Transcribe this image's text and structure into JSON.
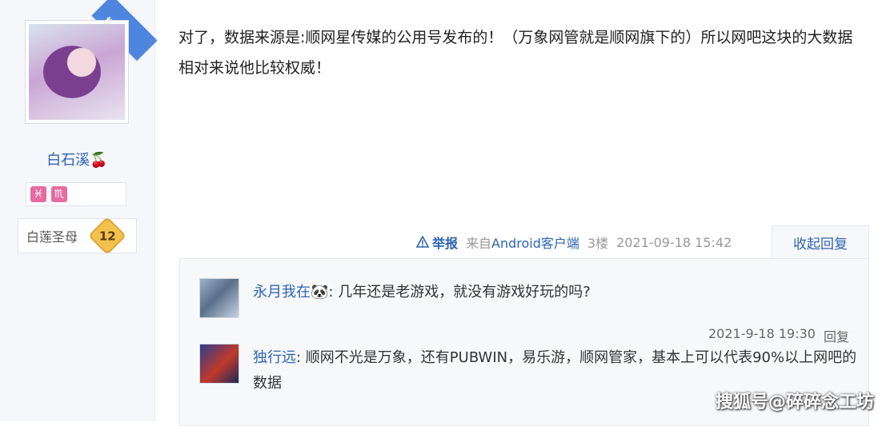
{
  "sidebar": {
    "badge": "楼主",
    "username": "白石溪🍒",
    "signs": [
      "♓",
      "♏"
    ],
    "rank_title": "白莲圣母",
    "level": "12"
  },
  "post": {
    "text": "对了，数据来源是:顺网星传媒的公用号发布的！（万象网管就是顺网旗下的）所以网吧这块的大数据相对来说他比较权威！"
  },
  "meta": {
    "report": "举报",
    "from_prefix": "来自",
    "from_app": "Android客户端",
    "floor": "3楼",
    "time": "2021-09-18 15:42",
    "collapse": "收起回复"
  },
  "replies": [
    {
      "name": "永月我在🐼",
      "sep": ":",
      "content": " 几年还是老游戏，就没有游戏好玩的吗?",
      "time": "2021-9-18 19:30",
      "reply_label": "回复"
    },
    {
      "name": "独行远",
      "sep": ":",
      "content": " 顺网不光是万象，还有PUBWIN，易乐游，顺网管家，基本上可以代表90%以上网吧的数据"
    }
  ],
  "watermark": "搜狐号@碎碎念工坊",
  "colors": {
    "link": "#2d64b3",
    "badge": "#4e86df",
    "level": "#f2c14e"
  }
}
